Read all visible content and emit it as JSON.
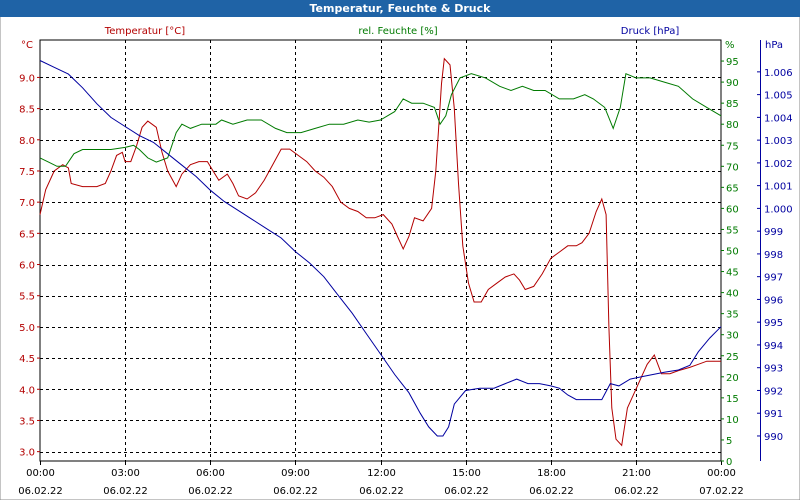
{
  "window": {
    "title": "Temperatur, Feuchte & Druck"
  },
  "colors": {
    "temperature": "#b30000",
    "humidity": "#007a00",
    "pressure": "#0000a0",
    "grid": "#000000",
    "titlebar": "#1f63a6"
  },
  "chart_data": {
    "type": "line",
    "title": "Temperatur, Feuchte & Druck",
    "grid": true,
    "x_ticks": [
      {
        "time": "00:00",
        "date": "06.02.22",
        "h": 0
      },
      {
        "time": "03:00",
        "date": "06.02.22",
        "h": 3
      },
      {
        "time": "06:00",
        "date": "06.02.22",
        "h": 6
      },
      {
        "time": "09:00",
        "date": "06.02.22",
        "h": 9
      },
      {
        "time": "12:00",
        "date": "06.02.22",
        "h": 12
      },
      {
        "time": "15:00",
        "date": "06.02.22",
        "h": 15
      },
      {
        "time": "18:00",
        "date": "06.02.22",
        "h": 18
      },
      {
        "time": "21:00",
        "date": "06.02.22",
        "h": 21
      },
      {
        "time": "00:00",
        "date": "07.02.22",
        "h": 24
      }
    ],
    "xlim": [
      0,
      24
    ],
    "axes": {
      "temperature": {
        "label": "Temperatur [°C]",
        "unit": "°C",
        "ylim": [
          2.85,
          9.6
        ],
        "ticks": [
          "3.0",
          "3.5",
          "4.0",
          "4.5",
          "5.0",
          "5.5",
          "6.0",
          "6.5",
          "7.0",
          "7.5",
          "8.0",
          "8.5",
          "9.0"
        ]
      },
      "humidity": {
        "label": "rel. Feuchte [%]",
        "unit": "%",
        "ylim": [
          0,
          100
        ],
        "ticks": [
          "0",
          "5",
          "10",
          "15",
          "20",
          "25",
          "30",
          "35",
          "40",
          "45",
          "50",
          "55",
          "60",
          "65",
          "70",
          "75",
          "80",
          "85",
          "90",
          "95"
        ]
      },
      "pressure": {
        "label": "Druck [hPa]",
        "unit": "hPa",
        "ylim": [
          988.9,
          1007.4
        ],
        "ticks": [
          "990",
          "991",
          "992",
          "993",
          "994",
          "995",
          "996",
          "997",
          "998",
          "999",
          "1.000",
          "1.001",
          "1.002",
          "1.003",
          "1.004",
          "1.005",
          "1.006"
        ]
      }
    },
    "series": [
      {
        "name": "Temperatur [°C]",
        "axis": "temperature",
        "points": [
          [
            0,
            6.8
          ],
          [
            0.2,
            7.2
          ],
          [
            0.5,
            7.5
          ],
          [
            0.8,
            7.6
          ],
          [
            1.0,
            7.55
          ],
          [
            1.1,
            7.3
          ],
          [
            1.5,
            7.25
          ],
          [
            2.0,
            7.25
          ],
          [
            2.3,
            7.3
          ],
          [
            2.5,
            7.5
          ],
          [
            2.7,
            7.75
          ],
          [
            2.9,
            7.8
          ],
          [
            3.0,
            7.65
          ],
          [
            3.2,
            7.65
          ],
          [
            3.4,
            7.9
          ],
          [
            3.6,
            8.2
          ],
          [
            3.8,
            8.3
          ],
          [
            4.1,
            8.2
          ],
          [
            4.3,
            7.8
          ],
          [
            4.5,
            7.5
          ],
          [
            4.8,
            7.25
          ],
          [
            5.0,
            7.45
          ],
          [
            5.3,
            7.6
          ],
          [
            5.6,
            7.65
          ],
          [
            5.9,
            7.65
          ],
          [
            6.1,
            7.5
          ],
          [
            6.3,
            7.35
          ],
          [
            6.6,
            7.45
          ],
          [
            6.8,
            7.3
          ],
          [
            7.0,
            7.1
          ],
          [
            7.3,
            7.05
          ],
          [
            7.6,
            7.15
          ],
          [
            7.9,
            7.35
          ],
          [
            8.2,
            7.6
          ],
          [
            8.5,
            7.85
          ],
          [
            8.8,
            7.85
          ],
          [
            9.1,
            7.75
          ],
          [
            9.4,
            7.65
          ],
          [
            9.7,
            7.5
          ],
          [
            10.0,
            7.4
          ],
          [
            10.3,
            7.25
          ],
          [
            10.6,
            7.0
          ],
          [
            10.9,
            6.9
          ],
          [
            11.2,
            6.85
          ],
          [
            11.5,
            6.75
          ],
          [
            11.8,
            6.75
          ],
          [
            12.1,
            6.8
          ],
          [
            12.4,
            6.65
          ],
          [
            12.6,
            6.45
          ],
          [
            12.8,
            6.25
          ],
          [
            13.0,
            6.45
          ],
          [
            13.2,
            6.75
          ],
          [
            13.5,
            6.7
          ],
          [
            13.8,
            6.9
          ],
          [
            13.95,
            7.5
          ],
          [
            14.05,
            8.2
          ],
          [
            14.15,
            8.9
          ],
          [
            14.25,
            9.3
          ],
          [
            14.45,
            9.2
          ],
          [
            14.6,
            8.5
          ],
          [
            14.75,
            7.3
          ],
          [
            14.9,
            6.3
          ],
          [
            15.1,
            5.7
          ],
          [
            15.3,
            5.4
          ],
          [
            15.55,
            5.4
          ],
          [
            15.8,
            5.6
          ],
          [
            16.1,
            5.7
          ],
          [
            16.4,
            5.8
          ],
          [
            16.7,
            5.85
          ],
          [
            16.9,
            5.75
          ],
          [
            17.1,
            5.6
          ],
          [
            17.4,
            5.65
          ],
          [
            17.7,
            5.85
          ],
          [
            18.0,
            6.1
          ],
          [
            18.3,
            6.2
          ],
          [
            18.6,
            6.3
          ],
          [
            18.9,
            6.3
          ],
          [
            19.1,
            6.35
          ],
          [
            19.35,
            6.5
          ],
          [
            19.6,
            6.85
          ],
          [
            19.8,
            7.05
          ],
          [
            19.95,
            6.8
          ],
          [
            20.05,
            5.0
          ],
          [
            20.15,
            3.7
          ],
          [
            20.3,
            3.2
          ],
          [
            20.5,
            3.1
          ],
          [
            20.7,
            3.7
          ],
          [
            21.0,
            4.0
          ],
          [
            21.2,
            4.2
          ],
          [
            21.4,
            4.4
          ],
          [
            21.65,
            4.55
          ],
          [
            21.9,
            4.25
          ],
          [
            22.2,
            4.25
          ],
          [
            22.5,
            4.3
          ],
          [
            22.9,
            4.35
          ],
          [
            23.2,
            4.4
          ],
          [
            23.5,
            4.45
          ],
          [
            23.8,
            4.45
          ],
          [
            24.0,
            4.45
          ]
        ]
      },
      {
        "name": "rel. Feuchte [%]",
        "axis": "humidity",
        "points": [
          [
            0,
            72
          ],
          [
            0.3,
            71
          ],
          [
            0.6,
            70
          ],
          [
            0.9,
            70
          ],
          [
            1.2,
            73
          ],
          [
            1.5,
            74
          ],
          [
            2.0,
            74
          ],
          [
            2.5,
            74
          ],
          [
            3.0,
            74.5
          ],
          [
            3.3,
            75
          ],
          [
            3.5,
            74
          ],
          [
            3.8,
            72
          ],
          [
            4.1,
            71
          ],
          [
            4.5,
            72
          ],
          [
            4.8,
            78
          ],
          [
            5.0,
            80
          ],
          [
            5.3,
            79
          ],
          [
            5.7,
            80
          ],
          [
            6.2,
            80
          ],
          [
            6.4,
            81
          ],
          [
            6.8,
            80
          ],
          [
            7.3,
            81
          ],
          [
            7.8,
            81
          ],
          [
            8.3,
            79
          ],
          [
            8.7,
            78
          ],
          [
            9.2,
            78
          ],
          [
            9.7,
            79
          ],
          [
            10.2,
            80
          ],
          [
            10.7,
            80
          ],
          [
            11.2,
            81
          ],
          [
            11.6,
            80.5
          ],
          [
            12.0,
            81
          ],
          [
            12.5,
            83
          ],
          [
            12.8,
            86
          ],
          [
            13.1,
            85
          ],
          [
            13.5,
            85
          ],
          [
            13.9,
            84
          ],
          [
            14.1,
            80
          ],
          [
            14.3,
            82
          ],
          [
            14.5,
            87
          ],
          [
            14.8,
            91
          ],
          [
            15.2,
            92
          ],
          [
            15.7,
            91
          ],
          [
            16.2,
            89
          ],
          [
            16.6,
            88
          ],
          [
            17.0,
            89
          ],
          [
            17.4,
            88
          ],
          [
            17.8,
            88
          ],
          [
            18.3,
            86
          ],
          [
            18.8,
            86
          ],
          [
            19.2,
            87
          ],
          [
            19.5,
            86
          ],
          [
            19.9,
            84
          ],
          [
            20.2,
            79
          ],
          [
            20.45,
            84
          ],
          [
            20.65,
            92
          ],
          [
            21.0,
            91
          ],
          [
            21.5,
            91
          ],
          [
            22.0,
            90
          ],
          [
            22.5,
            89
          ],
          [
            23.0,
            86
          ],
          [
            23.5,
            84
          ],
          [
            24.0,
            82
          ]
        ]
      },
      {
        "name": "Druck [hPa]",
        "axis": "pressure",
        "points": [
          [
            0,
            1006.5
          ],
          [
            0.5,
            1006.2
          ],
          [
            1.0,
            1005.9
          ],
          [
            1.5,
            1005.3
          ],
          [
            2.0,
            1004.6
          ],
          [
            2.5,
            1004.0
          ],
          [
            3.0,
            1003.6
          ],
          [
            3.5,
            1003.2
          ],
          [
            4.0,
            1002.9
          ],
          [
            4.5,
            1002.4
          ],
          [
            5.0,
            1001.9
          ],
          [
            5.5,
            1001.4
          ],
          [
            6.0,
            1000.8
          ],
          [
            6.5,
            1000.3
          ],
          [
            7.0,
            999.9
          ],
          [
            7.5,
            999.5
          ],
          [
            8.0,
            999.1
          ],
          [
            8.5,
            998.7
          ],
          [
            9.0,
            998.1
          ],
          [
            9.5,
            997.6
          ],
          [
            10.0,
            997.0
          ],
          [
            10.5,
            996.2
          ],
          [
            11.0,
            995.4
          ],
          [
            11.5,
            994.5
          ],
          [
            12.0,
            993.6
          ],
          [
            12.5,
            992.7
          ],
          [
            13.0,
            991.9
          ],
          [
            13.4,
            991.0
          ],
          [
            13.7,
            990.4
          ],
          [
            14.0,
            990.0
          ],
          [
            14.2,
            990.0
          ],
          [
            14.4,
            990.4
          ],
          [
            14.6,
            991.4
          ],
          [
            15.0,
            992.0
          ],
          [
            15.5,
            992.1
          ],
          [
            16.0,
            992.1
          ],
          [
            16.4,
            992.3
          ],
          [
            16.8,
            992.5
          ],
          [
            17.2,
            992.3
          ],
          [
            17.6,
            992.3
          ],
          [
            18.0,
            992.2
          ],
          [
            18.3,
            992.1
          ],
          [
            18.6,
            991.8
          ],
          [
            18.9,
            991.6
          ],
          [
            19.2,
            991.6
          ],
          [
            19.5,
            991.6
          ],
          [
            19.8,
            991.6
          ],
          [
            20.1,
            992.3
          ],
          [
            20.4,
            992.2
          ],
          [
            20.8,
            992.5
          ],
          [
            21.2,
            992.6
          ],
          [
            21.6,
            992.7
          ],
          [
            22.0,
            992.8
          ],
          [
            22.5,
            992.9
          ],
          [
            22.9,
            993.1
          ],
          [
            23.2,
            993.7
          ],
          [
            23.6,
            994.3
          ],
          [
            24.0,
            994.8
          ]
        ]
      }
    ]
  }
}
